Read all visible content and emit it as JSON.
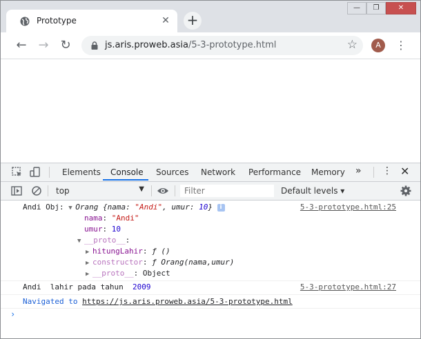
{
  "tab": {
    "title": "Prototype",
    "close": "✕"
  },
  "newtab": {
    "label": "+"
  },
  "window_controls": {
    "minimize": "—",
    "maximize": "❐",
    "close": "✕"
  },
  "nav": {
    "back": "←",
    "forward": "→",
    "reload": "↻"
  },
  "omnibox": {
    "domain": "js.aris.proweb.asia",
    "path": "/5-3-prototype.html",
    "star": "☆"
  },
  "profile": {
    "initial": "A"
  },
  "menu": {
    "kebab": "⋮"
  },
  "devtools": {
    "tabs": [
      "Elements",
      "Console",
      "Sources",
      "Network",
      "Performance",
      "Memory"
    ],
    "active_tab": "Console",
    "more": "»",
    "menu": "⋮",
    "close": "✕"
  },
  "console_toolbar": {
    "context": "top",
    "context_arrow": "▼",
    "filter_placeholder": "Filter",
    "levels": "Default levels ▾"
  },
  "console": {
    "log1": {
      "label": "Andi Obj: ",
      "obj_name": "Orang ",
      "obj_open": "{nama: ",
      "obj_nama": "\"Andi\"",
      "obj_mid": ", umur: ",
      "obj_umur": "10",
      "obj_close": "}",
      "info": "i",
      "source": "5-3-prototype.html:25",
      "props": {
        "nama_key": "nama",
        "nama_val": "\"Andi\"",
        "umur_key": "umur",
        "umur_val": "10",
        "proto_key": "__proto__",
        "hitung_key": "hitungLahir",
        "hitung_val": "ƒ ()",
        "ctor_key": "constructor",
        "ctor_val": "ƒ Orang(nama,umur)",
        "proto2_key": "__proto__",
        "proto2_val": "Object"
      }
    },
    "log2": {
      "text": "Andi  lahir pada tahun  ",
      "year": "2009",
      "source": "5-3-prototype.html:27"
    },
    "nav": {
      "prefix": "Navigated to ",
      "url": "https://js.aris.proweb.asia/5-3-prototype.html"
    },
    "prompt": "›"
  },
  "colors": {
    "accent": "#1a73e8",
    "tabstrip": "#dee1e6",
    "close_button": "#c75050"
  }
}
